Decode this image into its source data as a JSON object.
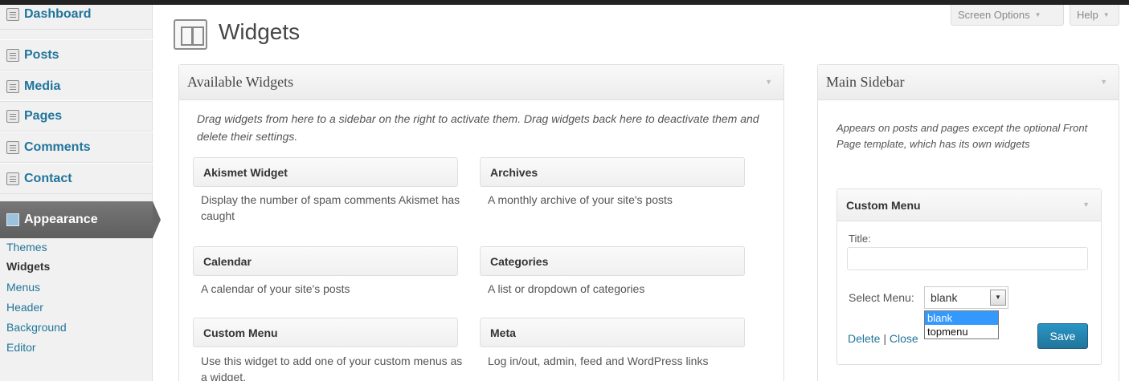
{
  "admin_menu": {
    "items": [
      {
        "label": "Dashboard",
        "icon": "dashboard-icon"
      },
      {
        "label": "Posts",
        "icon": "pin-icon"
      },
      {
        "label": "Media",
        "icon": "media-icon"
      },
      {
        "label": "Pages",
        "icon": "pages-icon"
      },
      {
        "label": "Comments",
        "icon": "comment-bubble-icon"
      },
      {
        "label": "Contact",
        "icon": "contact-icon"
      }
    ],
    "appearance": {
      "label": "Appearance",
      "icon": "appearance-icon"
    },
    "submenu": [
      "Themes",
      "Widgets",
      "Menus",
      "Header",
      "Background",
      "Editor"
    ],
    "current_submenu": "Widgets"
  },
  "screen_meta": {
    "screen_options": "Screen Options",
    "help": "Help"
  },
  "page": {
    "title": "Widgets",
    "icon": "widgets-icon"
  },
  "available_widgets": {
    "heading": "Available Widgets",
    "description": "Drag widgets from here to a sidebar on the right to activate them. Drag widgets back here to deactivate them and delete their settings.",
    "widgets": [
      {
        "title": "Akismet Widget",
        "desc": "Display the number of spam comments Akismet has caught"
      },
      {
        "title": "Archives",
        "desc": "A monthly archive of your site's posts"
      },
      {
        "title": "Calendar",
        "desc": "A calendar of your site's posts"
      },
      {
        "title": "Categories",
        "desc": "A list or dropdown of categories"
      },
      {
        "title": "Custom Menu",
        "desc": "Use this widget to add one of your custom menus as a widget."
      },
      {
        "title": "Meta",
        "desc": "Log in/out, admin, feed and WordPress links"
      }
    ]
  },
  "main_sidebar": {
    "heading": "Main Sidebar",
    "description": "Appears on posts and pages except the optional Front Page template, which has its own widgets",
    "custom_menu": {
      "title": "Custom Menu",
      "title_label": "Title:",
      "title_value": "",
      "select_label": "Select Menu:",
      "selected": "blank",
      "options": [
        "blank",
        "topmenu"
      ],
      "delete_label": "Delete",
      "separator": "|",
      "close_label": "Close",
      "save_label": "Save"
    }
  },
  "colors": {
    "link": "#21759b",
    "appearance_bg": "#6d6d6d",
    "save_button": "#21759b",
    "dropdown_highlight": "#3399ff"
  }
}
